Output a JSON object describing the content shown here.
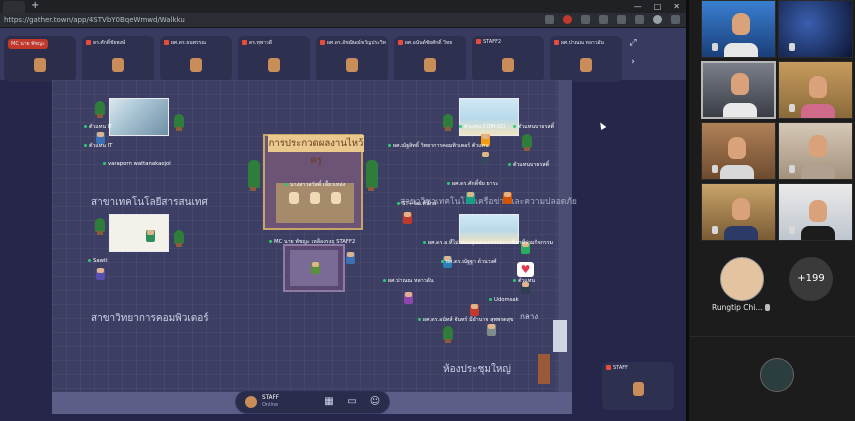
{
  "browser": {
    "url": "https://gather.town/app/4STVbY0BqeWmwd/Walkku",
    "window_controls": [
      "—",
      "□",
      "✕"
    ],
    "new_tab": "+"
  },
  "gather": {
    "tiles": [
      {
        "name": "MC นาย พัชญะ"
      },
      {
        "name": "ดร.ศักดิ์ชัยพงษ์"
      },
      {
        "name": "ผศ.ดร.ธนพรรณ"
      },
      {
        "name": "ดร.ทุพาวดี"
      },
      {
        "name": "ผศ.ดร.อัชฌิษณ์ขวัญประวิท"
      },
      {
        "name": "ผศ.อนันต์ชัยศักดิ์ วิทย"
      },
      {
        "name": "STAFF2"
      },
      {
        "name": "ผศ.ปาณณ หลาวอัน"
      }
    ],
    "rooms": {
      "it_dept": "สาขาเทคโนโลยีสารสนเทศ",
      "cs_dept": "สาขาวิทยาการคอมพิวเตอร์",
      "big_room": "ห้องประชุมใหญ่",
      "network_room": "สาขาวิชาเทคโนโลยีเครือข่ายและความปลอดภัย",
      "gang_room": "กลาง"
    },
    "stage_title": "การประกวดผลงานไหว้ครู",
    "name_tags": {
      "it1": "ตัวแทน IT",
      "it2": "ตัวแทน IT",
      "varaporn": "varaporn wattanakaejol",
      "sawit": "Sawit",
      "mc": "MC นาย พัชญะ เหลืองรงฤ STAFF2",
      "stage_judge": "นางสาวสวัสดิ์ เลี้ยวเหล่ง",
      "comsci": "ตัวแทน COM-SCI",
      "comsci2": "ตัวแทนบาธรสติ์",
      "ajarn_lead": "ผศ.ณัฐสิทธิ์ วิทยาการคอมพิวเตอร์ ตัวแทน",
      "rep": "ตัวแทนบาธรสติ์",
      "ajarn2": "ผศ.ดร.ศักดิ์ชัย ยาระ",
      "staff3": "ST+วัฒ.ที่นักษ์",
      "ajarn3": "ผศ.ดร.อ.ที่ไม่ ขอบคุณคณะกรรมการทีมาที่ร่วมกิจกรรม",
      "ajarn4": "ผศ.ดร.ณัฐฐา ด้วนวงศ์",
      "rep2": "ตัวแทน",
      "panan": "ผศ.ปาณณ หลาวอัน",
      "udomsak": "Udomsak",
      "ajarn5": "ผศ.ดร.อนัทส์ จันทร์ มีอำนาจ สุพพรตสุข"
    },
    "staff_card": "STAFF",
    "bottombar": {
      "name": "STAFF",
      "status": "Online",
      "map_icon": "▦",
      "screen_icon": "▭",
      "emoji_icon": "☺"
    },
    "heart": "♥",
    "nav_expand": "⤢",
    "nav_next": "›"
  },
  "zoom": {
    "participant_name": "Rungtip Chi...",
    "more_count": "+199"
  },
  "colors": {
    "accent_red": "#e74c3c",
    "online_green": "#2ecc71",
    "map_bg": "#3d3e63"
  }
}
